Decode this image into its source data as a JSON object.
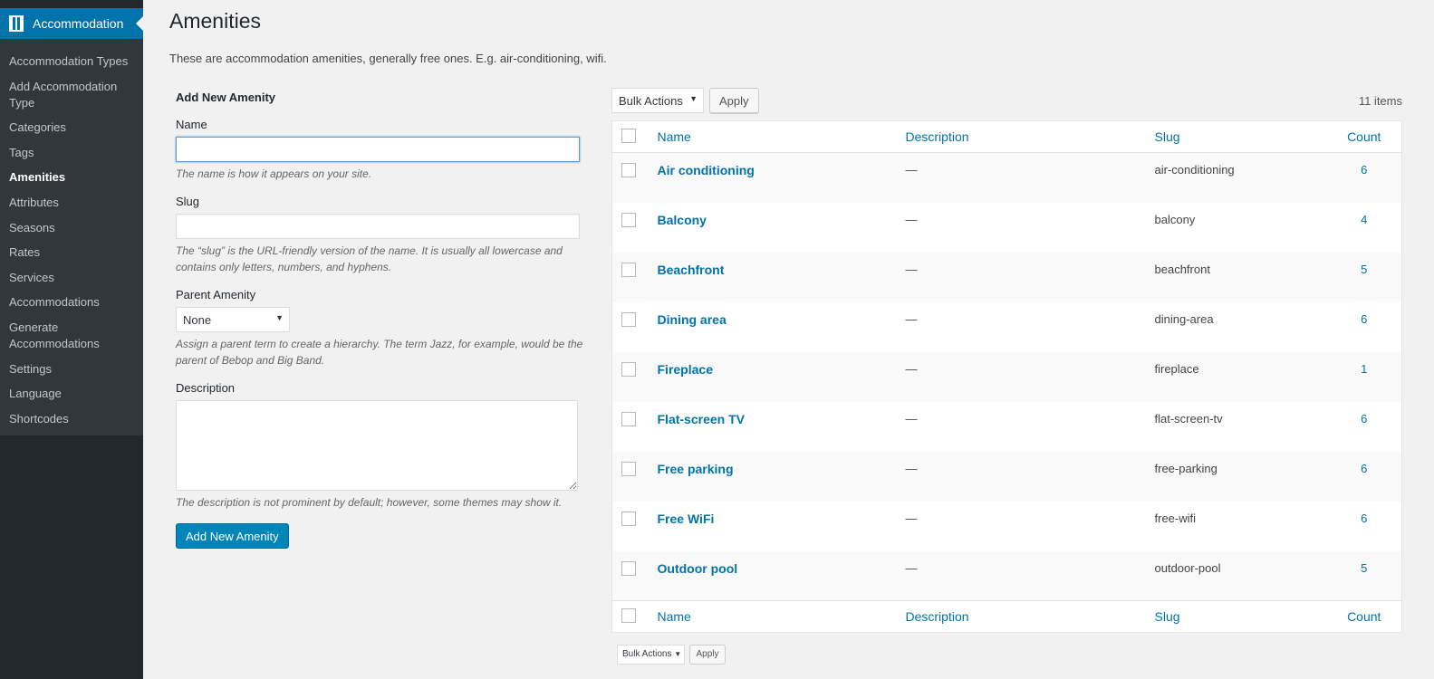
{
  "sidebar": {
    "menu_title": "Accommodation",
    "items": [
      "Accommodation Types",
      "Add Accommodation Type",
      "Categories",
      "Tags",
      "Amenities",
      "Attributes",
      "Seasons",
      "Rates",
      "Services",
      "Accommodations",
      "Generate Accommodations",
      "Settings",
      "Language",
      "Shortcodes"
    ],
    "current": "Amenities"
  },
  "page": {
    "title": "Amenities",
    "intro": "These are accommodation amenities, generally free ones. E.g. air-conditioning, wifi."
  },
  "form": {
    "heading": "Add New Amenity",
    "name_label": "Name",
    "name_value": "",
    "name_help": "The name is how it appears on your site.",
    "slug_label": "Slug",
    "slug_value": "",
    "slug_help": "The “slug” is the URL-friendly version of the name. It is usually all lowercase and contains only letters, numbers, and hyphens.",
    "parent_label": "Parent Amenity",
    "parent_value": "None",
    "parent_help": "Assign a parent term to create a hierarchy. The term Jazz, for example, would be the parent of Bebop and Big Band.",
    "desc_label": "Description",
    "desc_help": "The description is not prominent by default; however, some themes may show it.",
    "submit": "Add New Amenity"
  },
  "list": {
    "bulk_actions": "Bulk Actions",
    "apply": "Apply",
    "count": "11 items",
    "columns": {
      "name": "Name",
      "description": "Description",
      "slug": "Slug",
      "count": "Count"
    },
    "rows": [
      {
        "name": "Air conditioning",
        "description": "—",
        "slug": "air-conditioning",
        "count": "6"
      },
      {
        "name": "Balcony",
        "description": "—",
        "slug": "balcony",
        "count": "4"
      },
      {
        "name": "Beachfront",
        "description": "—",
        "slug": "beachfront",
        "count": "5"
      },
      {
        "name": "Dining area",
        "description": "—",
        "slug": "dining-area",
        "count": "6"
      },
      {
        "name": "Fireplace",
        "description": "—",
        "slug": "fireplace",
        "count": "1"
      },
      {
        "name": "Flat-screen TV",
        "description": "—",
        "slug": "flat-screen-tv",
        "count": "6"
      },
      {
        "name": "Free parking",
        "description": "—",
        "slug": "free-parking",
        "count": "6"
      },
      {
        "name": "Free WiFi",
        "description": "—",
        "slug": "free-wifi",
        "count": "6"
      },
      {
        "name": "Outdoor pool",
        "description": "—",
        "slug": "outdoor-pool",
        "count": "5"
      }
    ]
  },
  "colors": {
    "accent": "#0073aa",
    "sidebar": "#23282d",
    "submenu": "#32373c",
    "button": "#0085ba"
  }
}
